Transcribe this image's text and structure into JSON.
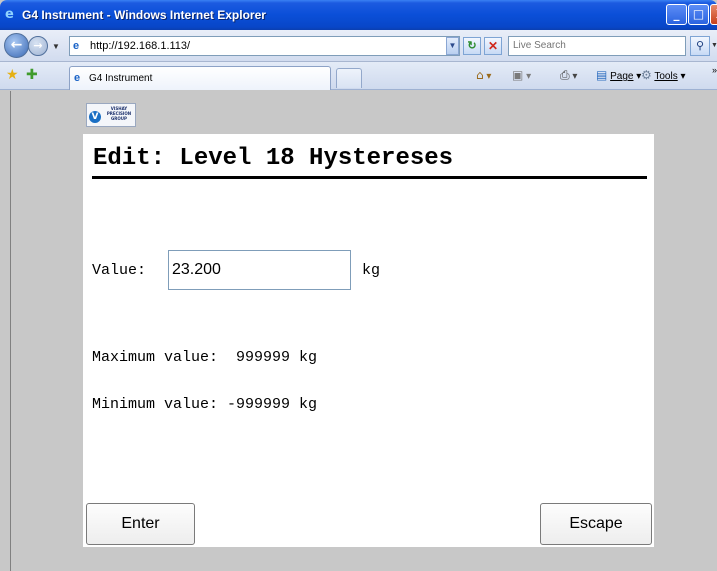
{
  "window": {
    "title": "G4 Instrument - Windows Internet Explorer",
    "min_glyph": "_",
    "max_glyph": "□",
    "close_glyph": "X"
  },
  "address_bar": {
    "url": "http://192.168.1.113/",
    "search_placeholder": "Live Search"
  },
  "tabs": [
    {
      "label": "G4 Instrument"
    }
  ],
  "command_bar": {
    "page_label": "Page",
    "tools_label": "Tools"
  },
  "logo": {
    "lines": "VISHAY PRECISION GROUP",
    "mark": "V"
  },
  "form": {
    "title": "Edit: Level 18 Hystereses",
    "value_label": "Value:",
    "value": "23.200",
    "unit": "kg",
    "max_line": "Maximum value:  999999 kg",
    "min_line": "Minimum value: -999999 kg",
    "enter_label": "Enter",
    "escape_label": "Escape"
  },
  "icons": {
    "back": "back-arrow-icon",
    "forward": "forward-arrow-icon",
    "refresh": "refresh-icon",
    "stop": "stop-icon",
    "search": "search-icon",
    "favorites": "star-icon",
    "home": "home-icon",
    "feeds": "feeds-icon",
    "print": "print-icon"
  },
  "colors": {
    "titlebar": "#0a4fd8",
    "page_bg": "#c8c8c8",
    "panel_bg": "#ffffff"
  }
}
